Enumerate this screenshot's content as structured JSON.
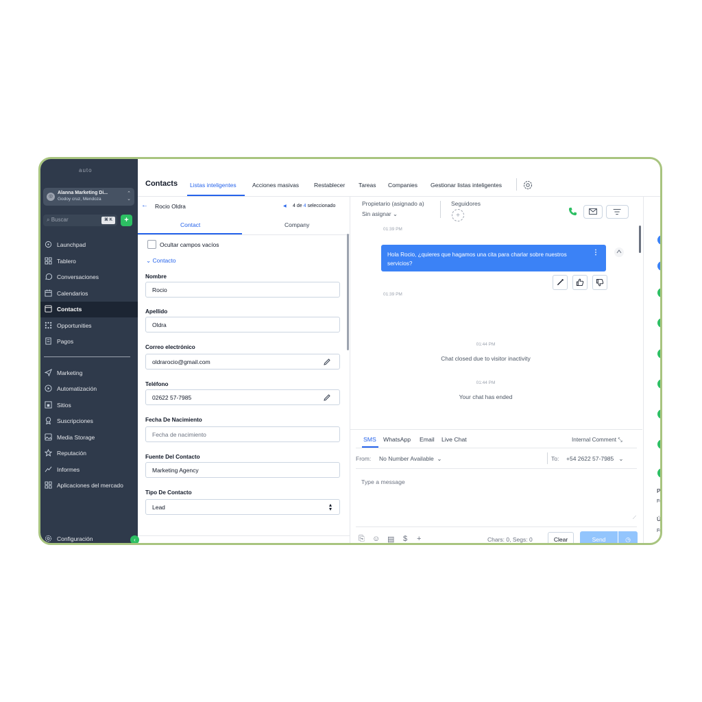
{
  "sidebar": {
    "logo": "auto",
    "account": {
      "name": "Alanna Marketing Di...",
      "location": "Godoy cruz, Mendoza"
    },
    "search": {
      "placeholder": "Buscar",
      "shortcut": "⌘ K"
    },
    "items": [
      {
        "label": "Launchpad",
        "icon": "rocket-icon"
      },
      {
        "label": "Tablero",
        "icon": "dashboard-icon"
      },
      {
        "label": "Conversaciones",
        "icon": "chat-icon"
      },
      {
        "label": "Calendarios",
        "icon": "calendar-icon"
      },
      {
        "label": "Contacts",
        "icon": "contacts-icon",
        "active": true
      },
      {
        "label": "Opportunities",
        "icon": "opportunities-icon"
      },
      {
        "label": "Pagos",
        "icon": "payments-icon"
      },
      {
        "label": "Marketing",
        "icon": "send-icon"
      },
      {
        "label": "Automatización",
        "icon": "automation-icon"
      },
      {
        "label": "Sitios",
        "icon": "sites-icon"
      },
      {
        "label": "Suscripciones",
        "icon": "badge-icon"
      },
      {
        "label": "Media Storage",
        "icon": "image-icon"
      },
      {
        "label": "Reputación",
        "icon": "star-icon"
      },
      {
        "label": "Informes",
        "icon": "trend-icon"
      },
      {
        "label": "Aplicaciones del mercado",
        "icon": "apps-icon"
      },
      {
        "label": "Configuración",
        "icon": "gear-icon"
      }
    ]
  },
  "topbar": {
    "title": "Contacts",
    "tabs": [
      "Listas inteligentes",
      "Acciones masivas",
      "Restablecer",
      "Tareas",
      "Companies",
      "Gestionar listas inteligentes"
    ]
  },
  "contact": {
    "name": "Rocio Oldra",
    "pager": {
      "current": "4",
      "of": "de",
      "total": "4",
      "suffix": "seleccionado"
    },
    "tabs": [
      "Contact",
      "Company"
    ],
    "hide_empty": "Ocultar campos vacíos",
    "section": "Contacto",
    "fields": [
      {
        "label": "Nombre",
        "value": "Rocio"
      },
      {
        "label": "Apellido",
        "value": "Oldra"
      },
      {
        "label": "Correo electrónico",
        "value": "oldrarocio@gmail.com"
      },
      {
        "label": "Teléfono",
        "value": "02622 57-7985"
      },
      {
        "label": "Fecha De Nacimiento",
        "placeholder": "Fecha de nacimiento"
      },
      {
        "label": "Fuente Del Contacto",
        "value": "Marketing Agency"
      },
      {
        "label": "Tipo De Contacto",
        "value": "Lead"
      }
    ]
  },
  "conversation": {
    "owner_label": "Propietario (asignado a)",
    "owner_value": "Sin asignar",
    "followers_label": "Seguidores",
    "messages": [
      {
        "time": "01:39 PM"
      },
      {
        "text": "Hola Rocio, ¿quieres que hagamos una cita para charlar sobre nuestros servicios?"
      },
      {
        "time": "01:39 PM"
      }
    ],
    "system": [
      {
        "time": "01:44 PM",
        "text": "Chat closed due to visitor inactivity"
      },
      {
        "time": "01:44 PM",
        "text": "Your chat has ended"
      }
    ],
    "composer": {
      "channels": [
        "SMS",
        "WhatsApp",
        "Email",
        "Live Chat"
      ],
      "internal_comment": "Internal Comment",
      "from_label": "From:",
      "from_value": "No Number Available",
      "to_label": "To:",
      "to_value": "+54 2622 57-7985",
      "placeholder": "Type a message",
      "chars": "Chars: 0, Segs: 0",
      "clear": "Clear",
      "send": "Send"
    }
  },
  "right_strip": {
    "texts": [
      "Pr",
      "Fu",
      "Úl",
      "Fu"
    ]
  },
  "colors": {
    "accent": "#2563eb",
    "sidebar": "#2f3a4b",
    "green": "#2dbf63",
    "frame": "#a8c47f"
  }
}
